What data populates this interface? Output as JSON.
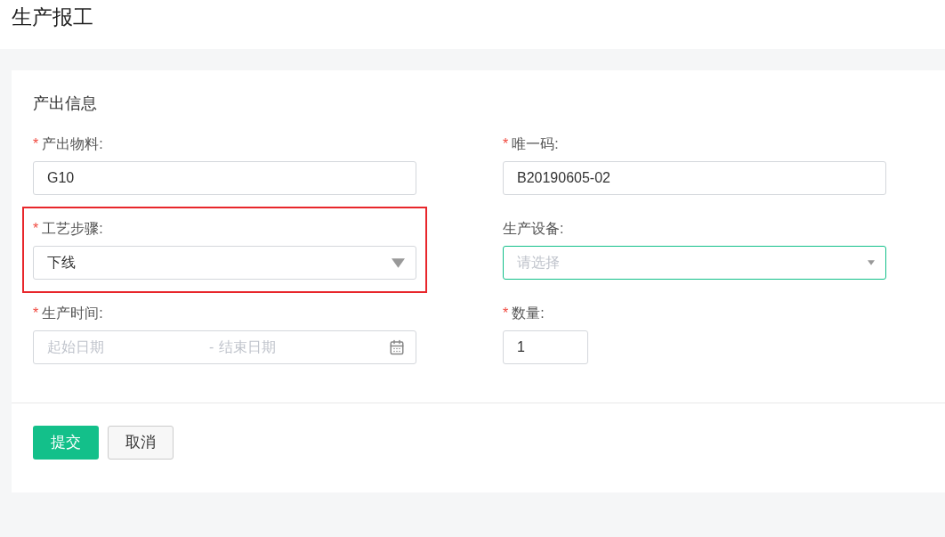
{
  "page": {
    "title": "生产报工"
  },
  "section": {
    "title": "产出信息"
  },
  "fields": [
    {
      "kind": "text",
      "required_mark": "*",
      "label": "产出物料:",
      "value": "G10",
      "focused": false,
      "highlighted": false
    },
    {
      "kind": "text",
      "required_mark": "*",
      "label": "唯一码:",
      "value": "B20190605-02",
      "focused": false,
      "highlighted": false
    },
    {
      "kind": "select",
      "required_mark": "*",
      "label": "工艺步骤:",
      "value": "下线",
      "focused": false,
      "highlighted": true
    },
    {
      "kind": "select",
      "label": "生产设备:",
      "placeholder": "请选择",
      "focused": true,
      "highlighted": false
    },
    {
      "kind": "daterange",
      "required_mark": "*",
      "label": "生产时间:",
      "start_placeholder": "起始日期",
      "separator": "-",
      "end_placeholder": "结束日期",
      "focused": false,
      "highlighted": false
    },
    {
      "kind": "number",
      "required_mark": "*",
      "label": "数量:",
      "value": "1",
      "focused": false,
      "highlighted": false
    }
  ],
  "buttons": [
    {
      "label": "提交",
      "kind": "primary"
    },
    {
      "label": "取消",
      "kind": "default"
    }
  ]
}
